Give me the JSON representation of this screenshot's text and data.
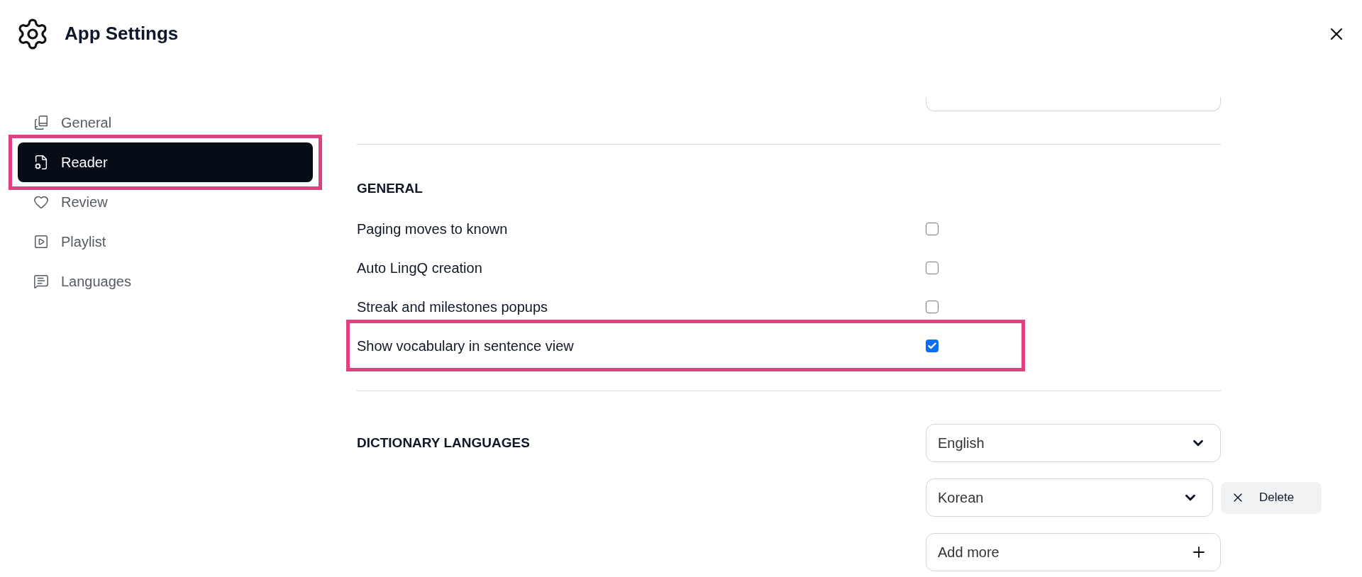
{
  "window": {
    "title": "App Settings"
  },
  "sidebar": {
    "items": [
      {
        "label": "General",
        "selected": false,
        "highlighted": false
      },
      {
        "label": "Reader",
        "selected": true,
        "highlighted": true
      },
      {
        "label": "Review",
        "selected": false,
        "highlighted": false
      },
      {
        "label": "Playlist",
        "selected": false,
        "highlighted": false
      },
      {
        "label": "Languages",
        "selected": false,
        "highlighted": false
      }
    ]
  },
  "sections": [
    {
      "kind": "checkboxes",
      "heading": "GENERAL",
      "settings": [
        {
          "label": "Paging moves to known",
          "checked": false,
          "highlighted": false
        },
        {
          "label": "Auto LingQ creation",
          "checked": false,
          "highlighted": false
        },
        {
          "label": "Streak and milestones popups",
          "checked": false,
          "highlighted": false
        },
        {
          "label": "Show vocabulary in sentence view",
          "checked": true,
          "highlighted": true
        }
      ]
    },
    {
      "kind": "languages",
      "heading": "DICTIONARY LANGUAGES",
      "languages": [
        {
          "value": "English"
        },
        {
          "value": "Korean",
          "delete_label": "Delete"
        }
      ],
      "add_label": "Add more"
    }
  ]
}
